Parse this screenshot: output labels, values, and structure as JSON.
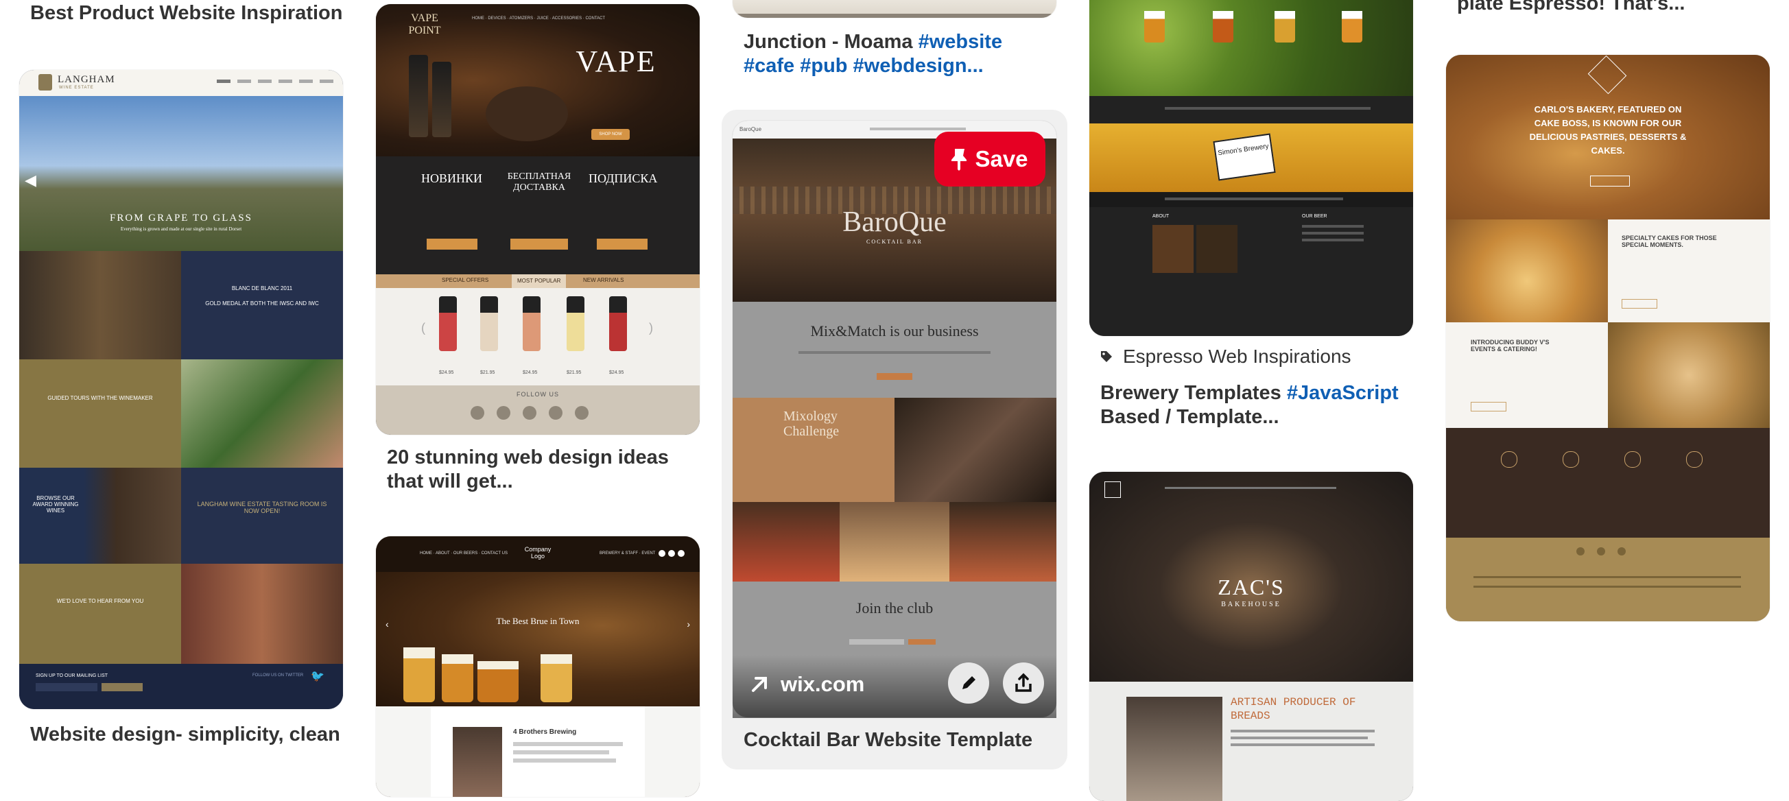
{
  "pins": [
    {
      "title": "Best Product Website Inspiration",
      "tags": ""
    },
    {
      "title": "Website design- simplicity, clean",
      "tags": ""
    },
    {
      "title": "20 stunning web design ideas that will get...",
      "tags": ""
    },
    {
      "title_prefix": "Junction - Moama ",
      "tags": "#website #cafe #pub #webdesign..."
    },
    {
      "title": "Cocktail Bar Website Template",
      "tags": ""
    },
    {
      "board": "Espresso Web Inspirations",
      "title_prefix": "Brewery Templates ",
      "tags": "#JavaScript",
      "title_suffix": "Based / Template..."
    },
    {
      "title": "plate Espresso! That's..."
    }
  ],
  "hover_pin": {
    "save_label": "Save",
    "link_label": "wix.com"
  },
  "thumbs": {
    "langham": {
      "brand": "LANGHAM",
      "sub": "WINE ESTATE",
      "hero": "FROM GRAPE TO GLASS",
      "hero_sub": "Everything is grown and made at our single site in rural Dorset",
      "feature1": "BLANC DE BLANC 2011",
      "feature1b": "GOLD MEDAL AT BOTH THE IWSC AND IWC",
      "tours": "GUIDED TOURS WITH THE WINEMAKER",
      "browse": "BROWSE OUR AWARD WINNING WINES",
      "news": "LANGHAM WINE ESTATE TASTING ROOM IS NOW OPEN!",
      "contact": "WE'D LOVE TO HEAR FROM YOU",
      "newsletter": "SIGN UP TO OUR MAILING LIST",
      "twitter": "FOLLOW US ON TWITTER"
    },
    "vape": {
      "logo": "VAPE POINT",
      "tab1": "SPECIAL OFFERS",
      "tab2": "MOST POPULAR",
      "tab3": "NEW ARRIVALS",
      "follow": "FOLLOW US",
      "cyr1": "НОВИНКИ",
      "cyr2": "БЕСПЛАТНАЯ ДОСТАВКА",
      "cyr3": "ПОДПИСКА",
      "prices": [
        "$24.95",
        "$21.95",
        "$24.95",
        "$21.95",
        "$24.95"
      ]
    },
    "beer": {
      "logo": "Company Logo",
      "hero": "The Best Brue in Town",
      "card_title": "4 Brothers Brewing"
    },
    "baroque": {
      "logo": "BaroQue",
      "tagline": "COCKTAIL BAR",
      "mix": "Mix&Match is our business",
      "mixology": "Mixology Challenge",
      "club": "Join the club"
    },
    "brewery": {
      "badge": "Simon's Brewery",
      "about": "ABOUT",
      "our_beer": "OUR BEER"
    },
    "zacs": {
      "name": "ZAC'S",
      "sub": "BAKEHOUSE",
      "artisan": "ARTISAN PRODUCER OF BREADS"
    },
    "bakery": {
      "hero": "CARLO'S BAKERY, FEATURED ON CAKE BOSS, IS KNOWN FOR OUR DELICIOUS PASTRIES, DESSERTS & CAKES.",
      "special": "SPECIALTY CAKES FOR THOSE SPECIAL MOMENTS.",
      "buddy": "INTRODUCING BUDDY V'S EVENTS & CATERING!"
    }
  },
  "colors": {
    "save_red": "#e60023",
    "tag_blue": "#0f5fb4",
    "title_text": "#333333"
  }
}
